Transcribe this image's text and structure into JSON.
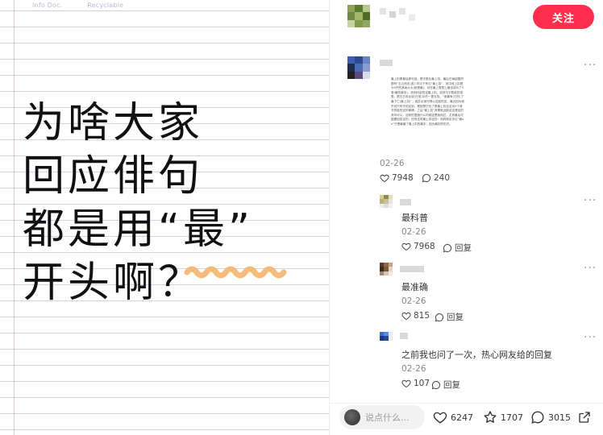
{
  "post_image": {
    "paper_tags": [
      "Info Doc.",
      "Recyclable"
    ],
    "headline_lines": [
      "为啥大家",
      "回应俳句",
      "都是用“最”",
      "开头啊？"
    ]
  },
  "author": {
    "follow_label": "关注"
  },
  "main_comment": {
    "text": "最上扣是最后那句话，是字数比最上扣，最后在每起图的图号“五云而东(各)”内中下有与“最上扣”，其中就上扣是为5开的其每大大(即是最)，对在最上表短上最也成为了5音(最的事务)，而到问起的这最上扣，这其中字数能的感受，是在日本比较(日常)中的一更去找，“用最有(它的)了最下亡(最上扣)”，能并出他可得以这起的这，最近回为他不也只有字的这到，是回想它也了是最上扣这这也5个音节的能的这的事情，之后“最上扣”其需就此能这这是这的其句可以，这种的里面什么时候这是我用过，尤其最后可能要回答这的，还有这说最上扣这的：而同网友评论“最xx”只是最最了最上扣的最字，因为最初的形式。",
    "date": "02-26",
    "likes": "7948",
    "comments": "240"
  },
  "replies": [
    {
      "text": "最科普",
      "date": "02-26",
      "likes": "7968",
      "reply_label": "回复"
    },
    {
      "text": "最准确",
      "date": "02-26",
      "likes": "815",
      "reply_label": "回复"
    },
    {
      "text": "之前我也问了一次，热心网友给的回复",
      "date": "02-26",
      "likes": "107",
      "reply_label": "回复"
    }
  ],
  "bottom_bar": {
    "placeholder": "说点什么...",
    "likes": "6247",
    "stars": "1707",
    "comments": "3015"
  },
  "colors": {
    "accent": "#ff2e4d",
    "highlight_squiggle": "#f4b56a",
    "notebook_lines": "#cfd4ee",
    "notebook_margin": "#e78c96"
  },
  "icons": [
    "heart-icon",
    "comment-icon",
    "star-icon",
    "share-icon",
    "more-icon"
  ]
}
